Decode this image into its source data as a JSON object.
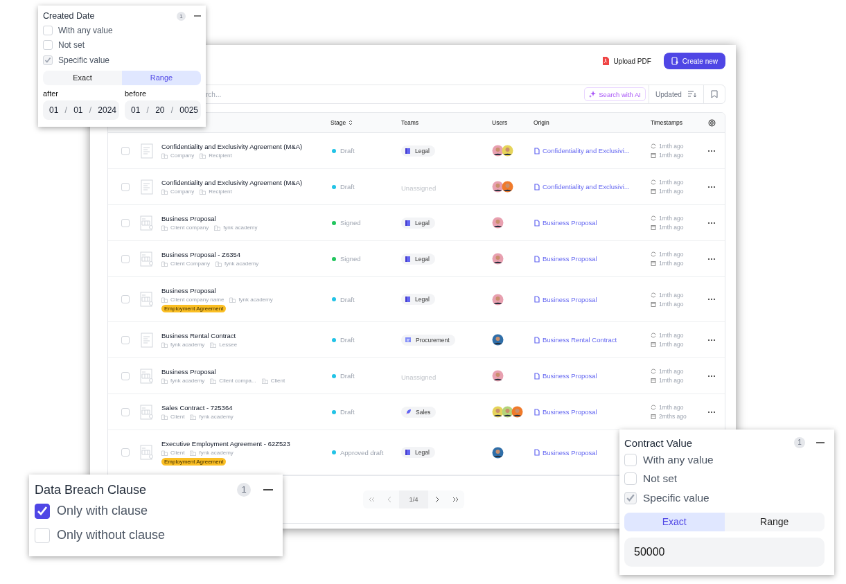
{
  "header": {
    "upload_label": "Upload PDF",
    "create_label": "Create new"
  },
  "search": {
    "placeholder": "rch...",
    "ai_label": "Search with AI",
    "sort_label": "Updated"
  },
  "table": {
    "columns": [
      {
        "label": "Stage",
        "sortable": true
      },
      {
        "label": "Teams",
        "sortable": false
      },
      {
        "label": "Users",
        "sortable": false
      },
      {
        "label": "Origin",
        "sortable": false
      },
      {
        "label": "Timestamps",
        "sortable": false
      }
    ],
    "rows": [
      {
        "selected": false,
        "kind": "plain",
        "title": "Confidentiality and Exclusivity Agreement (M&A)",
        "parties": [
          "Company",
          "Recipient"
        ],
        "stage": {
          "label": "Draft",
          "color": "#22c3e6"
        },
        "team": {
          "label": "Legal",
          "kind": "legal"
        },
        "users": [
          {
            "color": "#e8a0b0"
          },
          {
            "color": "#e6d45a"
          }
        ],
        "origin": "Confidentiality and Exclusivi...",
        "updated": "1mth ago",
        "created": "1mth ago"
      },
      {
        "selected": false,
        "kind": "plain",
        "title": "Confidentiality and Exclusivity Agreement (M&A)",
        "parties": [
          "Company",
          "Recipient"
        ],
        "stage": {
          "label": "Draft",
          "color": "#22c3e6"
        },
        "team": {
          "label": "Unassigned",
          "kind": "none"
        },
        "users": [
          {
            "color": "#e8a0b0"
          },
          {
            "color": "#f07a2a"
          }
        ],
        "origin": "Confidentiality and Exclusivi...",
        "updated": "1mth ago",
        "created": "1mth ago"
      },
      {
        "selected": false,
        "kind": "form",
        "title": "Business Proposal",
        "parties": [
          "Client company",
          "fynk academy"
        ],
        "stage": {
          "label": "Signed",
          "color": "#22c55e"
        },
        "team": {
          "label": "Legal",
          "kind": "legal"
        },
        "users": [
          {
            "color": "#e8a0b0"
          }
        ],
        "origin": "Business Proposal",
        "updated": "1mth ago",
        "created": "1mth ago"
      },
      {
        "selected": false,
        "kind": "form",
        "title": "Business Proposal - Z6354",
        "parties": [
          "Client Company",
          "fynk academy"
        ],
        "stage": {
          "label": "Signed",
          "color": "#22c55e"
        },
        "team": {
          "label": "Legal",
          "kind": "legal"
        },
        "users": [
          {
            "color": "#e8a0b0"
          }
        ],
        "origin": "Business Proposal",
        "updated": "1mth ago",
        "created": "1mth ago"
      },
      {
        "selected": false,
        "kind": "form",
        "title": "Business Proposal",
        "parties": [
          "Client company name",
          "fynk academy"
        ],
        "tag": "Employment Agreement",
        "stage": {
          "label": "Draft",
          "color": "#22c3e6"
        },
        "team": {
          "label": "Legal",
          "kind": "legal"
        },
        "users": [
          {
            "color": "#e8a0b0"
          }
        ],
        "origin": "Business Proposal",
        "updated": "1mth ago",
        "created": "1mth ago"
      },
      {
        "selected": false,
        "kind": "plain",
        "title": "Business Rental Contract",
        "parties": [
          "fynk academy",
          "Lessee"
        ],
        "stage": {
          "label": "Draft",
          "color": "#22c3e6"
        },
        "team": {
          "label": "Procurement",
          "kind": "procurement"
        },
        "users": [
          {
            "color": "#2f6ea8"
          }
        ],
        "origin": "Business Rental Contract",
        "updated": "1mth ago",
        "created": "1mth ago"
      },
      {
        "selected": false,
        "kind": "form",
        "title": "Business Proposal",
        "parties": [
          "fynk academy",
          "Client compa...",
          "Client"
        ],
        "stage": {
          "label": "Draft",
          "color": "#22c3e6"
        },
        "team": {
          "label": "Unassigned",
          "kind": "none"
        },
        "users": [
          {
            "color": "#e8a0b0"
          }
        ],
        "origin": "Business Proposal",
        "updated": "1mth ago",
        "created": "1mth ago"
      },
      {
        "selected": false,
        "kind": "form",
        "title": "Sales Contract - 725364",
        "parties": [
          "Client",
          "fynk academy"
        ],
        "stage": {
          "label": "Draft",
          "color": "#22c3e6"
        },
        "team": {
          "label": "Sales",
          "kind": "sales"
        },
        "users": [
          {
            "color": "#e6d45a"
          },
          {
            "color": "#b5d47a"
          },
          {
            "color": "#f07a2a"
          }
        ],
        "origin": "Business Proposal",
        "updated": "1mth ago",
        "created": "2mths ago"
      },
      {
        "selected": false,
        "kind": "form",
        "title": "Executive Employment Agreement - 62Z523",
        "parties": [
          "Client",
          "fynk academy"
        ],
        "tag": "Employment Agreement",
        "stage": {
          "label": "Approved draft",
          "color": "#22c3e6"
        },
        "team": {
          "label": "Legal",
          "kind": "legal"
        },
        "users": [
          {
            "color": "#2f6ea8"
          }
        ],
        "origin": "Business Proposal"
      }
    ]
  },
  "pagination": {
    "page": "1/4"
  },
  "created_date_filter": {
    "title": "Created Date",
    "count": "1",
    "options": [
      {
        "label": "With any value",
        "checked": false,
        "disabled": false
      },
      {
        "label": "Not set",
        "checked": false,
        "disabled": false
      },
      {
        "label": "Specific value",
        "checked": true,
        "disabled": true
      }
    ],
    "modes": [
      {
        "label": "Exact",
        "selected": false
      },
      {
        "label": "Range",
        "selected": true
      }
    ],
    "separator": "/",
    "dates": [
      {
        "label": "after",
        "parts": [
          "01",
          "01",
          "2024"
        ]
      },
      {
        "label": "before",
        "parts": [
          "01",
          "20",
          "0025"
        ]
      }
    ]
  },
  "data_breach_filter": {
    "title": "Data Breach Clause",
    "count": "1",
    "options": [
      {
        "label": "Only with clause",
        "checked": true,
        "disabled": false
      },
      {
        "label": "Only without clause",
        "checked": false,
        "disabled": false
      }
    ]
  },
  "contract_value_filter": {
    "title": "Contract Value",
    "count": "1",
    "options": [
      {
        "label": "With any value",
        "checked": false,
        "disabled": false
      },
      {
        "label": "Not set",
        "checked": false,
        "disabled": false
      },
      {
        "label": "Specific value",
        "checked": true,
        "disabled": true
      }
    ],
    "modes": [
      {
        "label": "Exact",
        "selected": true
      },
      {
        "label": "Range",
        "selected": false
      }
    ],
    "value": "50000"
  }
}
